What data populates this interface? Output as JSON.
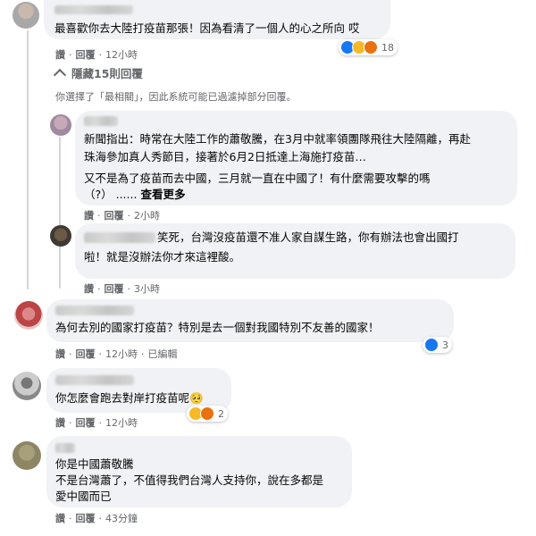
{
  "comments": [
    {
      "text": "最喜歡你去大陸打疫苗那張！因為看清了一個人的心之所向 哎",
      "actions": {
        "like": "讚",
        "reply": "回覆",
        "time": "12小時"
      },
      "reaction_count": "18"
    }
  ],
  "replies_toggle": {
    "label": "隱藏15則回覆"
  },
  "filter_note": "你選擇了「最相關」，因此系統可能已過濾掉部分回覆。",
  "replies": [
    {
      "lines": [
        "新聞指出：時常在大陸工作的蕭敬騰，在3月中就率領團隊飛往大陸隔離，再赴",
        "珠海參加真人秀節目，接著於6月2日抵達上海施打疫苗…",
        "又不是為了疫苗而去中國，三月就一直在中國了！有什麼需要攻擊的嗎",
        "（?） ......"
      ],
      "see_more": "查看更多",
      "actions": {
        "like": "讚",
        "reply": "回覆",
        "time": "2小時"
      }
    },
    {
      "lines": [
        "笑死，台灣沒疫苗還不准人家自謀生路，你有辦法也會出國打",
        "啦！就是沒辦法你才來這裡酸。"
      ],
      "actions": {
        "like": "讚",
        "reply": "回覆",
        "time": "3小時"
      }
    }
  ],
  "comments_more": [
    {
      "text": "為何去別的國家打疫苗？特別是去一個對我國特別不友善的國家！",
      "actions": {
        "like": "讚",
        "reply": "回覆",
        "time": "12小時",
        "edited": "已編輯"
      },
      "reaction_count": "3"
    },
    {
      "text": "你怎麼會跑去對岸打疫苗呢",
      "emoji": "🥺",
      "actions": {
        "like": "讚",
        "reply": "回覆",
        "time": "12小時"
      },
      "reaction_count": "2"
    },
    {
      "lines": [
        "你是中國蕭敬騰",
        "不是台灣蕭了，不值得我們台灣人支持你，說在多都是",
        "愛中國而已"
      ],
      "actions": {
        "like": "讚",
        "reply": "回覆",
        "time": "43分鐘"
      }
    }
  ],
  "colors": {
    "bubble": "#f0f2f5",
    "meta": "#65676b",
    "like": "#1877f2"
  }
}
